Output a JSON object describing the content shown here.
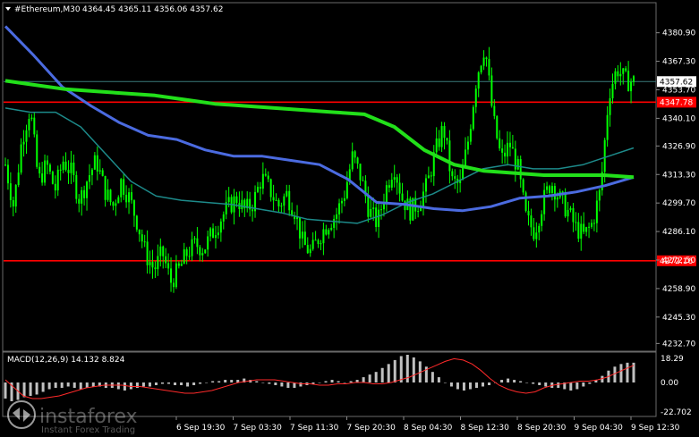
{
  "header": {
    "symbol_label": "#Ethereum,M30",
    "ohlc": "4364.45 4365.11 4356.06 4357.62"
  },
  "macd": {
    "label": "MACD(12,26,9) 14.132 8.824",
    "ticks": [
      "18.29",
      "0.00",
      "-22.702"
    ]
  },
  "watermark": {
    "brand": "instaforex",
    "tagline": "Instant Forex Trading"
  },
  "colors": {
    "background": "#000000",
    "candle": "#00ff00",
    "ma_green": "#22e01a",
    "ma_blue": "#4b6be0",
    "ma_teal": "#1d8a8a",
    "level_red": "#ff0000",
    "price_line": "#3b7a7a",
    "macd_hist": "#c0c0c0",
    "macd_signal": "#ff2a2a"
  },
  "chart_data": {
    "type": "candlestick",
    "instrument": "#Ethereum",
    "timeframe": "M30",
    "ylim": [
      4232,
      4388
    ],
    "y_ticks": [
      "4380.90",
      "4367.30",
      "4353.70",
      "4340.10",
      "4326.90",
      "4313.30",
      "4299.70",
      "4286.10",
      "4272.50",
      "4258.90",
      "4245.30",
      "4232.70"
    ],
    "x_ticks": [
      "6 Sep 19:30",
      "7 Sep 03:30",
      "7 Sep 11:30",
      "7 Sep 20:30",
      "8 Sep 04:30",
      "8 Sep 12:30",
      "8 Sep 20:30",
      "9 Sep 04:30",
      "9 Sep 12:30"
    ],
    "current_price": "4357.62",
    "horizontal_levels": [
      "4347.78",
      "4272.16"
    ],
    "close_path": [
      4318,
      4298,
      4330,
      4345,
      4310,
      4318,
      4306,
      4320,
      4314,
      4301,
      4312,
      4320,
      4306,
      4298,
      4310,
      4302,
      4290,
      4275,
      4268,
      4276,
      4262,
      4268,
      4276,
      4280,
      4278,
      4285,
      4292,
      4298,
      4302,
      4296,
      4300,
      4312,
      4306,
      4298,
      4304,
      4296,
      4280,
      4276,
      4284,
      4290,
      4294,
      4304,
      4322,
      4312,
      4296,
      4290,
      4306,
      4318,
      4302,
      4296,
      4300,
      4308,
      4324,
      4336,
      4310,
      4308,
      4330,
      4360,
      4375,
      4340,
      4320,
      4328,
      4316,
      4292,
      4286,
      4300,
      4310,
      4302,
      4296,
      4288,
      4284,
      4290,
      4306,
      4352,
      4364,
      4358,
      4357.62
    ],
    "ma_green": [
      4358,
      4356,
      4354,
      4353,
      4352,
      4351,
      4349,
      4347,
      4346,
      4345,
      4344,
      4343,
      4342,
      4336,
      4325,
      4318,
      4315,
      4314,
      4313,
      4313,
      4313,
      4312
    ],
    "ma_blue": [
      4384,
      4370,
      4355,
      4346,
      4338,
      4332,
      4330,
      4325,
      4322,
      4322,
      4320,
      4318,
      4311,
      4300,
      4299,
      4297,
      4296,
      4298,
      4302,
      4303,
      4305,
      4308,
      4312
    ],
    "ma_teal": [
      4345,
      4343,
      4343,
      4336,
      4323,
      4310,
      4303,
      4301,
      4300,
      4299,
      4297,
      4295,
      4292,
      4291,
      4290,
      4294,
      4300,
      4304,
      4310,
      4316,
      4318,
      4316,
      4316,
      4318,
      4322,
      4326
    ],
    "macd_series": {
      "name": "MACD(12,26,9)",
      "value": "14.132",
      "signal": "8.824",
      "hist": [
        -12,
        -14,
        -13,
        -11,
        -10,
        -9,
        -7,
        -5,
        -4,
        -4,
        -3,
        -4,
        -5,
        -4,
        -3,
        -3,
        -4,
        -4,
        -5,
        -6,
        -5,
        -4,
        -3,
        -3,
        -2,
        -1,
        -1,
        -2,
        -2,
        -3,
        -2,
        -1,
        0,
        1,
        1,
        2,
        2,
        2,
        3,
        2,
        1,
        0,
        -1,
        -2,
        -3,
        -4,
        -4,
        -3,
        -2,
        -1,
        0,
        1,
        2,
        1,
        0,
        1,
        2,
        4,
        6,
        8,
        11,
        14,
        17,
        20,
        21,
        19,
        16,
        12,
        8,
        4,
        0,
        -3,
        -5,
        -6,
        -5,
        -4,
        -3,
        -2,
        0,
        2,
        3,
        2,
        1,
        0,
        -1,
        -2,
        -3,
        -4,
        -4,
        -5,
        -6,
        -5,
        -3,
        -1,
        2,
        5,
        9,
        12,
        14,
        15,
        15
      ],
      "signal_values": [
        2,
        -4,
        -10,
        -12,
        -12,
        -11,
        -10,
        -8,
        -6,
        -4,
        -3,
        -2,
        -2,
        -2,
        -3,
        -3,
        -4,
        -5,
        -6,
        -7,
        -8,
        -8,
        -7,
        -6,
        -4,
        -2,
        0,
        1,
        2,
        2,
        2,
        1,
        0,
        -1,
        -1,
        -2,
        -2,
        -1,
        -1,
        0,
        0,
        -1,
        -1,
        0,
        2,
        4,
        7,
        10,
        13,
        16,
        18,
        17,
        14,
        9,
        3,
        -2,
        -5,
        -7,
        -8,
        -7,
        -4,
        -2,
        -1,
        0,
        1,
        1,
        2,
        4,
        7,
        10,
        13
      ]
    }
  }
}
